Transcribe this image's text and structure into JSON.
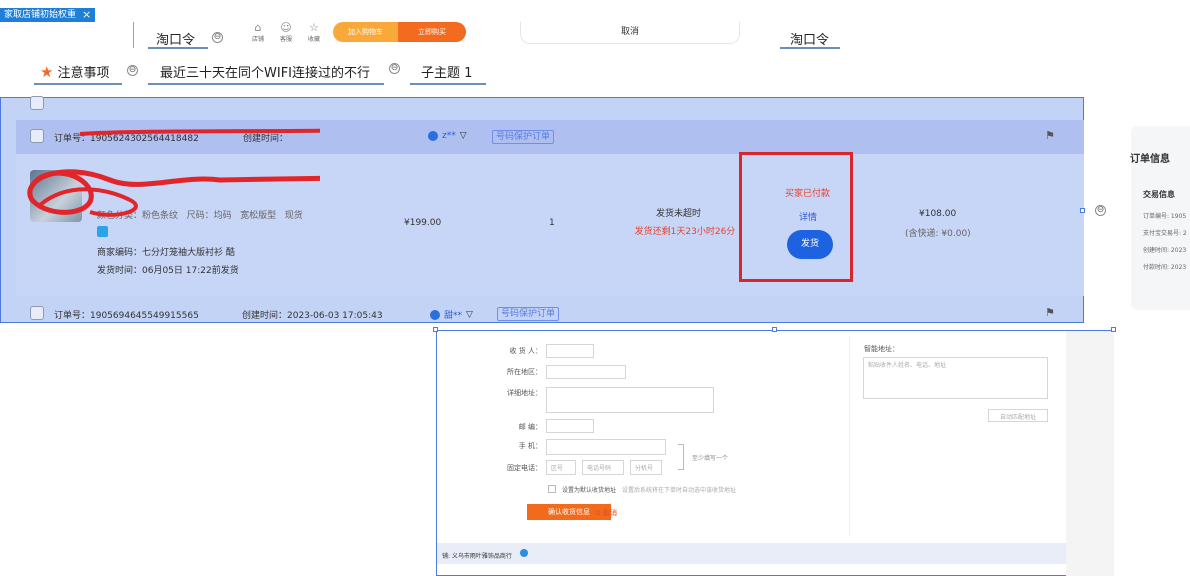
{
  "top_tab": {
    "title": "家取店铺初始权重",
    "close": "×"
  },
  "mindmap": {
    "node_taokou_left": "淘口令",
    "node_cancel": "取消",
    "node_taokou_right": "淘口令",
    "notes": "注意事项",
    "wifi_rule": "最近三十天在同个WIFI连接过的不行",
    "subtopic": "子主题 1",
    "mini_icons": [
      {
        "icon": "shop-icon",
        "label": "店铺"
      },
      {
        "icon": "service-icon",
        "label": "客服"
      },
      {
        "icon": "favorite-icon",
        "label": "收藏"
      }
    ],
    "add_cart": "加入购物车",
    "buy_now": "立即购买",
    "collapse": "⊖"
  },
  "order_header": {
    "order_no": "订单号：1905624302564418482",
    "created": "创建时间：",
    "buyer": "z**",
    "protect_tag": "号码保护订单"
  },
  "order_item": {
    "props": "颜色分类：粉色条纹   尺码：均码   宽松版型   现货",
    "merchant_code": "商家编码：七分灯笼袖大版衬衫  酷",
    "ship_time": "发货时间：06月05日 17:22前发货",
    "price": "¥199.00",
    "quantity": "1",
    "ship_status": "发货未超时",
    "ship_remaining": "发货还剩1天23小时26分",
    "order_status": "买家已付款",
    "detail_link": "详情",
    "ship_button": "发货",
    "total": "¥108.00",
    "shipping": "(含快递: ¥0.00)"
  },
  "order2_header": {
    "order_no": "订单号：1905694645549915565",
    "created": "创建时间：2023-06-03 17:05:43",
    "buyer": "甜**",
    "protect_tag": "号码保护订单"
  },
  "right_panel": {
    "title": "订单信息",
    "sub": "交易信息",
    "rows": [
      "订单编号: 1905",
      "支付宝交易号: 2",
      "创建时间: 2023",
      "付款时间: 2023"
    ]
  },
  "address_form": {
    "receiver": "收 货 人：",
    "region": "所在地区：",
    "detail": "详细地址：",
    "postcode": "邮    编：",
    "mobile": "手    机：",
    "phone": "固定电话：",
    "phone_area": "区号",
    "phone_number": "电话号码",
    "phone_ext": "分机号",
    "either_one": "至少填写一个",
    "default_label": "设置为默认收货地址",
    "default_hint": "设置后系统将在下单时自动选中该收货地址",
    "smart_label": "智能地址：",
    "smart_placeholder": "粘贴收件人姓名、电话、地址",
    "smart_button": "自动匹配地址",
    "confirm": "确认收货信息",
    "cancel": "⊙ 取消",
    "store": "铺: 义乌市雨叶雅饰品商行"
  }
}
